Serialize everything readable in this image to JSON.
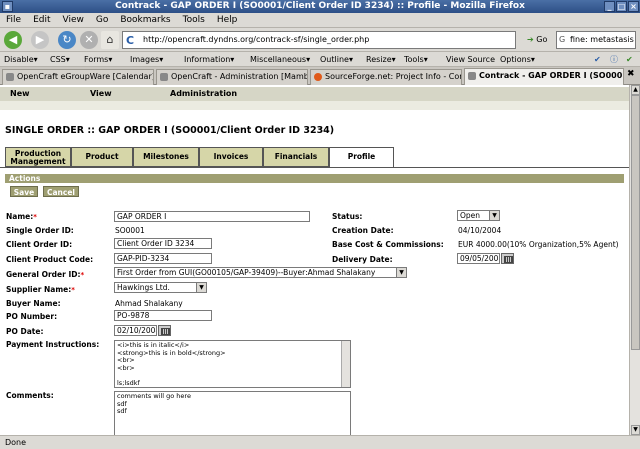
{
  "window": {
    "title": "Contrack - GAP ORDER I (SO0001/Client Order ID 3234) :: Profile - Mozilla Firefox"
  },
  "menubar": {
    "items": [
      "File",
      "Edit",
      "View",
      "Go",
      "Bookmarks",
      "Tools",
      "Help"
    ]
  },
  "navbar": {
    "url": "http://opencraft.dyndns.org/contrack-sf/single_order.php",
    "go_label": "Go",
    "search_value": "fine: metastasis"
  },
  "devbar": {
    "items": [
      "Disable▾",
      "CSS▾",
      "Forms▾",
      "Images▾",
      "Information▾",
      "Miscellaneous▾",
      "Outline▾",
      "Resize▾",
      "Tools▾",
      "View Source",
      "Options▾"
    ]
  },
  "tabs": [
    {
      "label": "OpenCraft eGroupWare [Calendar]"
    },
    {
      "label": "OpenCraft - Administration [Mambo]"
    },
    {
      "label": "SourceForge.net: Project Info - Contr..."
    },
    {
      "label": "Contrack - GAP ORDER I (SO000..."
    }
  ],
  "appmenu": {
    "items": [
      "New",
      "View",
      "Administration"
    ]
  },
  "page": {
    "title": "SINGLE ORDER :: GAP ORDER I (SO0001/Client Order ID 3234)",
    "order_tabs": [
      "Production Management",
      "Product",
      "Milestones",
      "Invoices",
      "Financials",
      "Profile"
    ],
    "actions_label": "Actions",
    "save_label": "Save",
    "cancel_label": "Cancel",
    "fields": {
      "name_label": "Name:",
      "name_value": "GAP ORDER I",
      "single_order_id_label": "Single Order ID:",
      "single_order_id_value": "SO0001",
      "client_order_id_label": "Client Order ID:",
      "client_order_id_value": "Client Order ID 3234",
      "client_product_code_label": "Client Product Code:",
      "client_product_code_value": "GAP-PID-3234",
      "general_order_id_label": "General Order ID:",
      "general_order_id_value": "First Order from GUI(GO00105/GAP-39409)--Buyer:Ahmad Shalakany",
      "supplier_name_label": "Supplier Name:",
      "supplier_name_value": "Hawkings Ltd.",
      "buyer_name_label": "Buyer Name:",
      "buyer_name_value": "Ahmad Shalakany",
      "po_number_label": "PO Number:",
      "po_number_value": "PO-9878",
      "po_date_label": "PO Date:",
      "po_date_value": "02/10/2004",
      "payment_instructions_label": "Payment Instructions:",
      "payment_instructions_lines": [
        "<i>this is in italic</i>",
        "<strong>this is in bold</strong>",
        "<br>",
        "<br>",
        "",
        "ls;lsdkf"
      ],
      "comments_label": "Comments:",
      "comments_lines": [
        "comments will go here",
        "sdf",
        "sdf"
      ],
      "status_label": "Status:",
      "status_value": "Open",
      "creation_date_label": "Creation Date:",
      "creation_date_value": "04/10/2004",
      "base_cost_label": "Base Cost & Commissions:",
      "base_cost_value": "EUR 4000.00(10% Organization,5% Agent)",
      "delivery_date_label": "Delivery Date:",
      "delivery_date_value": "09/05/2005"
    }
  },
  "status": {
    "text": "Done"
  }
}
